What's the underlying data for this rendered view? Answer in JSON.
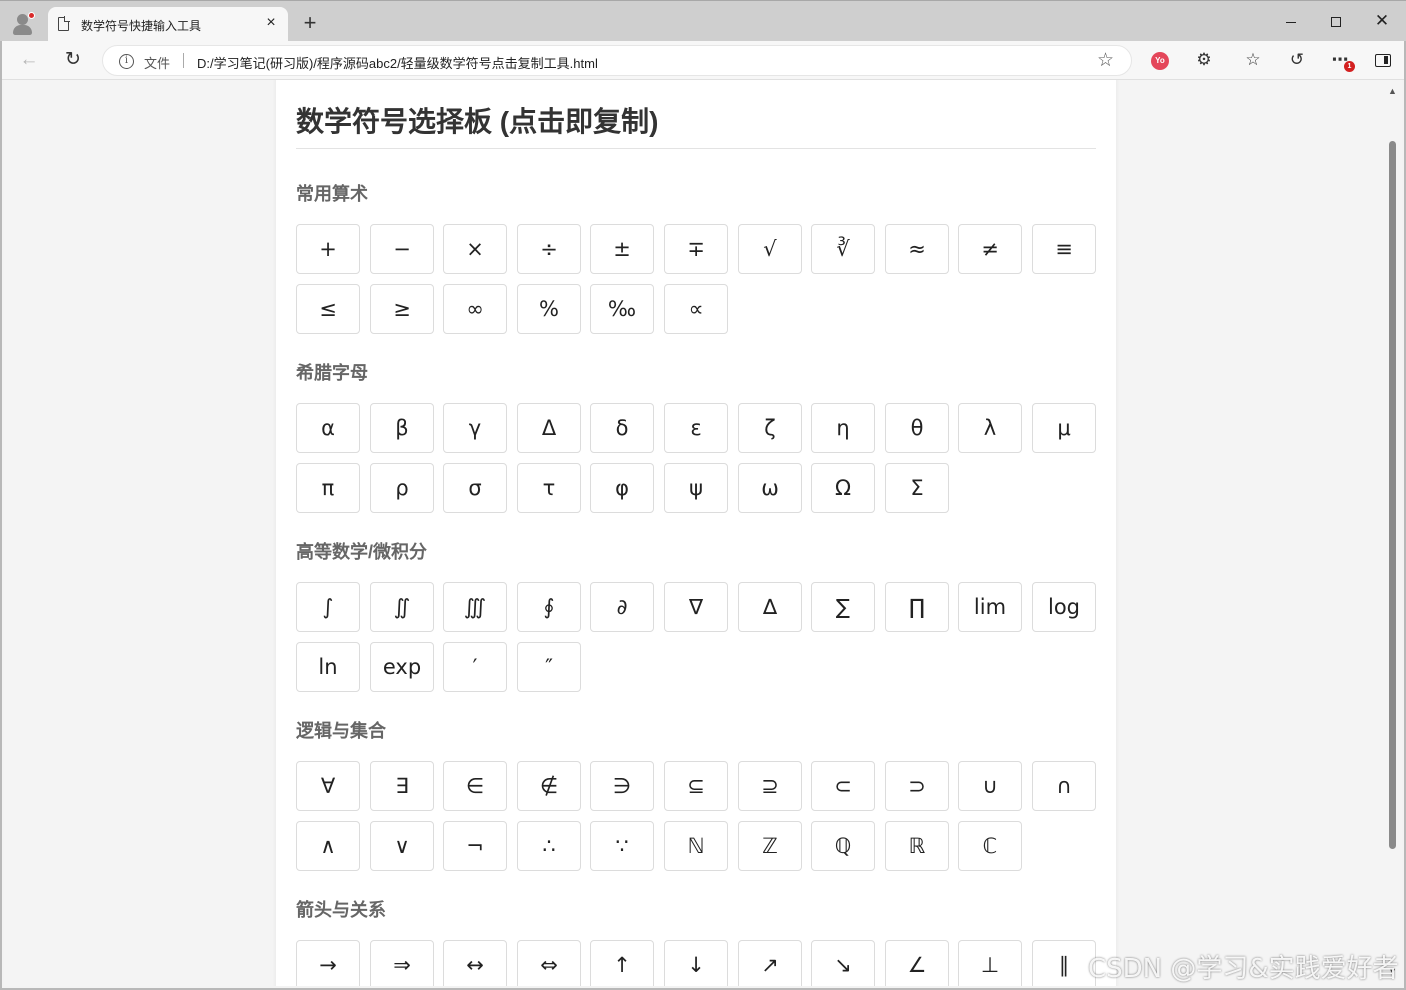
{
  "browser": {
    "tab_title": "数学符号快捷输入工具",
    "tab_close": "×",
    "new_tab": "+",
    "scheme_label": "文件",
    "url": "D:/学习笔记(研习版)/程序源码abc2/轻量级数学符号点击复制工具.html",
    "window_close": "✕",
    "info_glyph": "i",
    "ext_badge_text": "Yo",
    "notification_badge": "1"
  },
  "page": {
    "title": "数学符号选择板 (点击即复制)",
    "sections": [
      {
        "title": "常用算术",
        "symbols": [
          "+",
          "−",
          "×",
          "÷",
          "±",
          "∓",
          "√",
          "∛",
          "≈",
          "≠",
          "≡",
          "≤",
          "≥",
          "∞",
          "%",
          "‰",
          "∝"
        ]
      },
      {
        "title": "希腊字母",
        "symbols": [
          "α",
          "β",
          "γ",
          "Δ",
          "δ",
          "ε",
          "ζ",
          "η",
          "θ",
          "λ",
          "μ",
          "π",
          "ρ",
          "σ",
          "τ",
          "φ",
          "ψ",
          "ω",
          "Ω",
          "Σ"
        ]
      },
      {
        "title": "高等数学/微积分",
        "symbols": [
          "∫",
          "∬",
          "∭",
          "∮",
          "∂",
          "∇",
          "∆",
          "∑",
          "∏",
          "lim",
          "log",
          "ln",
          "exp",
          "′",
          "″"
        ]
      },
      {
        "title": "逻辑与集合",
        "symbols": [
          "∀",
          "∃",
          "∈",
          "∉",
          "∋",
          "⊆",
          "⊇",
          "⊂",
          "⊃",
          "∪",
          "∩",
          "∧",
          "∨",
          "¬",
          "∴",
          "∵",
          "ℕ",
          "ℤ",
          "ℚ",
          "ℝ",
          "ℂ"
        ]
      },
      {
        "title": "箭头与关系",
        "symbols": [
          "→",
          "⇒",
          "↔",
          "⇔",
          "↑",
          "↓",
          "↗",
          "↘",
          "∠",
          "⊥",
          "∥"
        ]
      }
    ]
  },
  "watermark": "CSDN @学习&实践爱好者"
}
